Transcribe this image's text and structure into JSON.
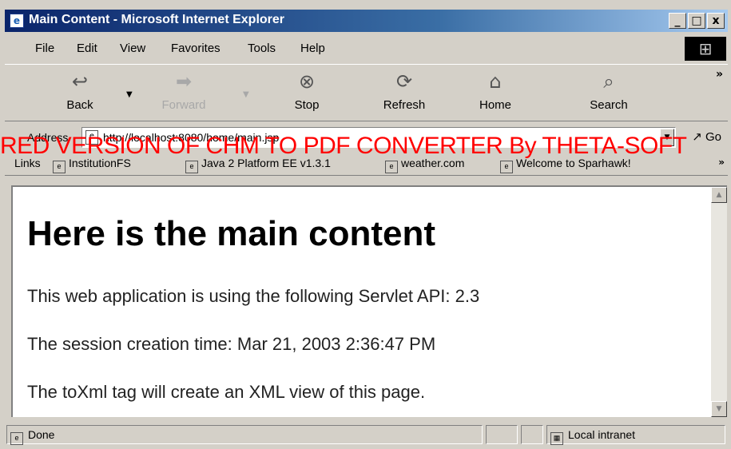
{
  "window": {
    "title": "Main Content - Microsoft Internet Explorer",
    "controls": {
      "minimize": "_",
      "maximize": "□",
      "close": "x"
    }
  },
  "menu": [
    "File",
    "Edit",
    "View",
    "Favorites",
    "Tools",
    "Help"
  ],
  "toolbar": {
    "back": "Back",
    "forward": "Forward",
    "stop": "Stop",
    "refresh": "Refresh",
    "home": "Home",
    "search": "Search",
    "more": "»"
  },
  "address": {
    "label": "Address",
    "url": "http://localhost:8080/home/main.jsp",
    "go": "Go"
  },
  "links": {
    "label": "Links",
    "items": [
      "InstitutionFS",
      "Java 2 Platform EE v1.3.1",
      "weather.com",
      "Welcome to Sparhawk!"
    ]
  },
  "watermark": "RED VERSION OF CHM TO PDF CONVERTER By THETA-SOFT",
  "content": {
    "heading": "Here is the main content",
    "paragraphs": [
      "This web application is using the following Servlet API: 2.3",
      "The session creation time: Mar 21, 2003 2:36:47 PM",
      "The toXml tag will create an XML view of this page."
    ]
  },
  "status": {
    "text": "Done",
    "zone": "Local intranet"
  }
}
